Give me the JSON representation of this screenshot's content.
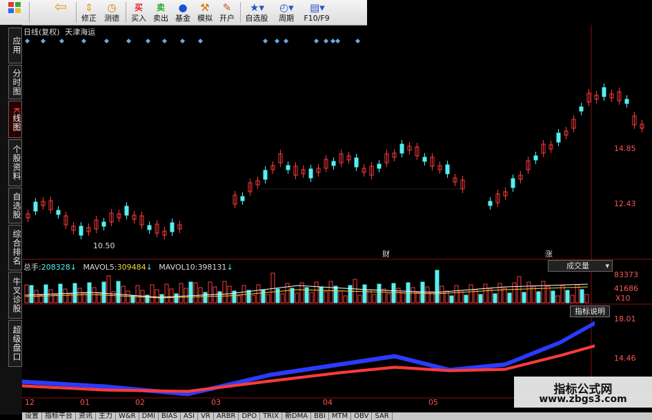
{
  "toolbar": {
    "items": [
      {
        "icon": "grid-icon",
        "label": ""
      },
      {
        "icon": "arrow-left-icon",
        "label": ""
      },
      {
        "icon": "arrow-updown-icon",
        "label": "修正"
      },
      {
        "icon": "clock-icon",
        "label": "测德"
      },
      {
        "icon": "buy-icon",
        "glyph": "买",
        "label": "买入"
      },
      {
        "icon": "sell-icon",
        "glyph": "卖",
        "label": "卖出"
      },
      {
        "icon": "fund-icon",
        "label": "基金"
      },
      {
        "icon": "simulate-icon",
        "label": "模拟"
      },
      {
        "icon": "open-account-icon",
        "label": "开户"
      },
      {
        "icon": "star-icon",
        "label": "自选股"
      },
      {
        "icon": "period-icon",
        "label": "周期"
      },
      {
        "icon": "f10-icon",
        "label": "F10/F9"
      }
    ]
  },
  "sidebar": {
    "tabs": [
      {
        "label": "应用"
      },
      {
        "label": "分时图"
      },
      {
        "label": "K线图",
        "k": "K",
        "rest": "线图"
      },
      {
        "label": "个股资料"
      },
      {
        "label": "自选股"
      },
      {
        "label": "综合排名"
      },
      {
        "label": "牛叉诊股"
      },
      {
        "label": "超级盘口"
      }
    ]
  },
  "kline": {
    "period_label": "日线(复权)",
    "stock_name": "天津海运",
    "price_levels": [
      "14.85",
      "12.43"
    ],
    "low_marker": "10.50",
    "markers": [
      "财",
      "涨"
    ]
  },
  "volume": {
    "total_label": "总手:",
    "total_value": "208328",
    "mavol5_label": "MAVOL5:",
    "mavol5_value": "309484",
    "mavol10_label": "MAVOL10:",
    "mavol10_value": "398131",
    "dropdown_label": "成交量",
    "scale_top": "83373",
    "scale_mid": "41686",
    "scale_unit": "X10"
  },
  "indicator": {
    "button_label": "指标说明",
    "scale_top": "18.01",
    "scale_mid": "14.46"
  },
  "x_axis": {
    "labels": [
      "12",
      "01",
      "02",
      "03",
      "04",
      "05"
    ]
  },
  "bottom_tabs": [
    "设置",
    "指标平台",
    "资讯",
    "主力",
    "W&R",
    "DMI",
    "BIAS",
    "ASI",
    "VR",
    "ARBR",
    "DPO",
    "TRIX",
    "新DMA",
    "BBI",
    "MTM",
    "OBV",
    "SAR"
  ],
  "watermark": {
    "title": "指标公式网",
    "url": "www.zbgs3.com"
  },
  "colors": {
    "up": "#ff3b3b",
    "down": "#54f0f0",
    "bg": "#000000",
    "accent_yellow": "#f4d83c",
    "blue_band": "#2c3cff"
  }
}
